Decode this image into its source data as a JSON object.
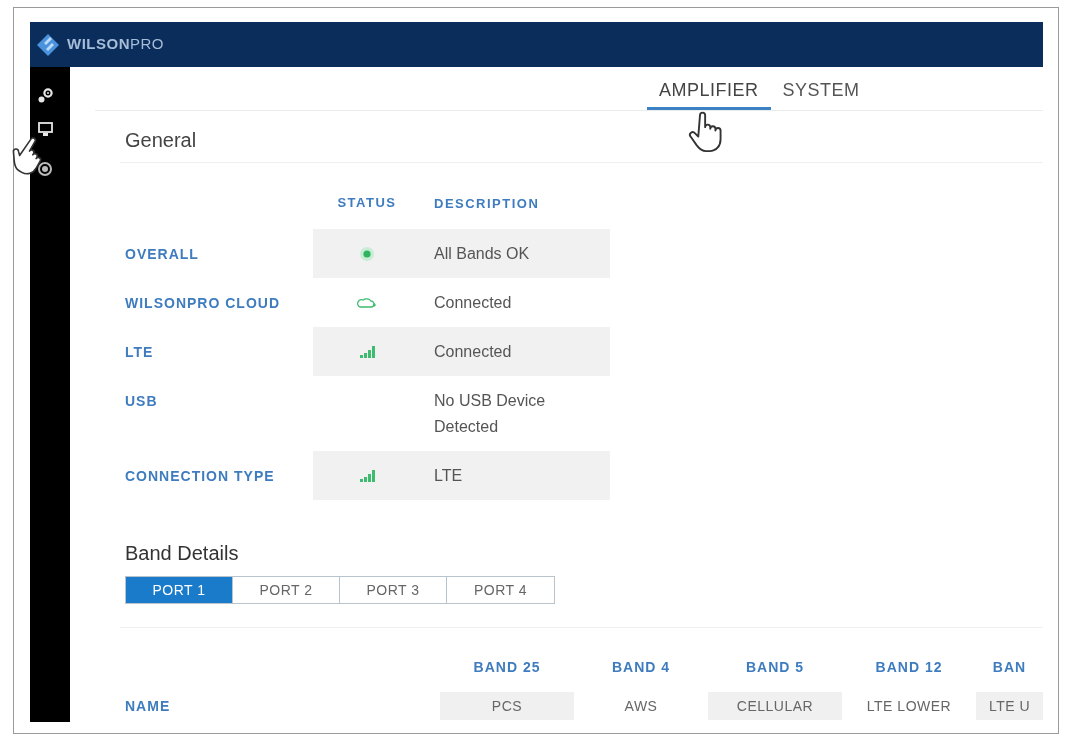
{
  "header": {
    "logo": "**WILSON**PRO"
  },
  "tabs": [
    {
      "label": "AMPLIFIER",
      "selected": true
    },
    {
      "label": "SYSTEM",
      "selected": false
    }
  ],
  "general": {
    "title": "General",
    "columns": [
      "STATUS",
      "DESCRIPTION"
    ],
    "rows": [
      {
        "label": "OVERALL",
        "kind": "dot",
        "description": "All Bands OK"
      },
      {
        "label": "WILSONPRO CLOUD",
        "kind": "cloud",
        "description": "Connected"
      },
      {
        "label": "LTE",
        "kind": "signal",
        "description": "Connected"
      },
      {
        "label": "USB",
        "kind": "none",
        "description": "No USB Device Detected"
      },
      {
        "label": "CONNECTION TYPE",
        "kind": "signal",
        "description": "LTE"
      }
    ]
  },
  "band_details": {
    "title": "Band Details",
    "ports": [
      {
        "label": "PORT 1",
        "selected": true
      },
      {
        "label": "PORT 2",
        "selected": false
      },
      {
        "label": "PORT 3",
        "selected": false
      },
      {
        "label": "PORT 4",
        "selected": false
      }
    ],
    "columns": [
      "BAND 25",
      "BAND 4",
      "BAND 5",
      "BAND 12",
      "BAN"
    ],
    "rows": [
      {
        "label": "NAME",
        "cells": [
          "PCS",
          "AWS",
          "CELLULAR",
          "LTE LOWER",
          "LTE U"
        ]
      }
    ]
  }
}
